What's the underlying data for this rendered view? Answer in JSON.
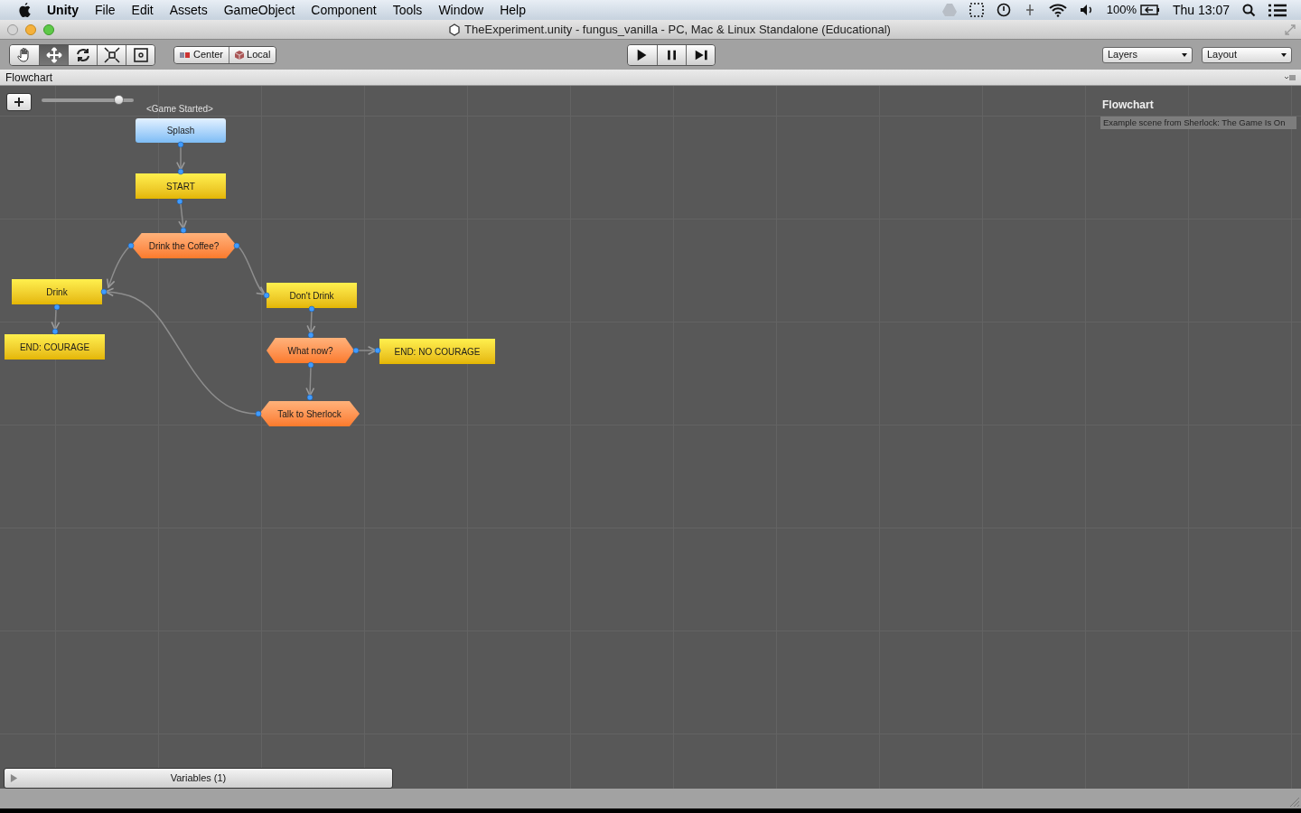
{
  "menu_bar": {
    "app": "Unity",
    "items": [
      "File",
      "Edit",
      "Assets",
      "GameObject",
      "Component",
      "Tools",
      "Window",
      "Help"
    ],
    "battery": "100%",
    "clock": "Thu 13:07"
  },
  "window": {
    "title": "TheExperiment.unity - fungus_vanilla - PC, Mac & Linux Standalone (Educational)"
  },
  "toolbar": {
    "tools": [
      {
        "kind": "hand",
        "selected": false
      },
      {
        "kind": "move",
        "selected": true
      },
      {
        "kind": "rotate",
        "selected": false
      },
      {
        "kind": "scale",
        "selected": false
      },
      {
        "kind": "rect",
        "selected": false
      }
    ],
    "pivot": [
      {
        "kind": "center",
        "label": "Center"
      },
      {
        "kind": "local",
        "label": "Local"
      }
    ],
    "playback": [
      {
        "kind": "play"
      },
      {
        "kind": "pause"
      },
      {
        "kind": "step"
      }
    ],
    "dropdowns": [
      "Layers",
      "Layout"
    ]
  },
  "tab": {
    "title": "Flowchart"
  },
  "flowchart": {
    "zoom": {
      "level": 0.83
    },
    "event_label": "<Game Started>",
    "nodes": [
      {
        "kind": "event",
        "label": "Splash"
      },
      {
        "kind": "block",
        "label": "START"
      },
      {
        "kind": "question",
        "label": "Drink the Coffee?"
      },
      {
        "kind": "block",
        "label": "Drink"
      },
      {
        "kind": "block",
        "label": "Don't Drink"
      },
      {
        "kind": "block",
        "label": "END: COURAGE"
      },
      {
        "kind": "question",
        "label": "What now?"
      },
      {
        "kind": "block",
        "label": "END: NO COURAGE"
      },
      {
        "kind": "question",
        "label": "Talk to Sherlock"
      }
    ],
    "info": {
      "title": "Flowchart",
      "description": "Example scene from Sherlock: The Game Is On"
    },
    "variables": {
      "label": "Variables (1)",
      "expanded": false
    }
  }
}
